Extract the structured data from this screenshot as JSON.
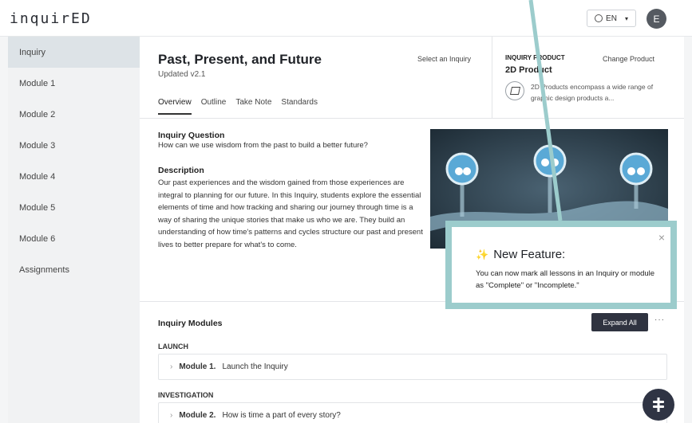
{
  "app": {
    "logo": "inquirED",
    "language": "EN",
    "avatar_initial": "E"
  },
  "sidebar": {
    "items": [
      {
        "label": "Inquiry",
        "active": true
      },
      {
        "label": "Module 1"
      },
      {
        "label": "Module 2"
      },
      {
        "label": "Module 3"
      },
      {
        "label": "Module 4"
      },
      {
        "label": "Module 5"
      },
      {
        "label": "Module 6"
      },
      {
        "label": "Assignments"
      }
    ]
  },
  "header": {
    "title": "Past, Present, and Future",
    "version": "Updated v2.1",
    "select_inquiry": "Select an Inquiry",
    "tabs": [
      {
        "label": "Overview",
        "active": true
      },
      {
        "label": "Outline"
      },
      {
        "label": "Take Note"
      },
      {
        "label": "Standards"
      }
    ]
  },
  "product": {
    "kicker": "INQUIRY PRODUCT",
    "change": "Change Product",
    "name": "2D Product",
    "description": "2D Products encompass a wide range of graphic design products a..."
  },
  "inquiry": {
    "question_heading": "Inquiry Question",
    "question": "How can we use wisdom from the past to build a better future?",
    "description_heading": "Description",
    "description": "Our past experiences and the wisdom gained from those experiences are integral to planning for our future. In this Inquiry, students explore the essential elements of time and how tracking and sharing our journey through time is a way of sharing the unique stories that make us who we are. They build an understanding of how time's patterns and cycles structure our past and present lives to better prepare for what's to come."
  },
  "modules": {
    "heading": "Inquiry Modules",
    "expand_all": "Expand All",
    "more": "···",
    "phases": [
      {
        "label": "LAUNCH",
        "module_num": "Module 1.",
        "module_title": "Launch the Inquiry"
      },
      {
        "label": "INVESTIGATION",
        "module_num": "Module 2.",
        "module_title": "How is time a part of every story?"
      }
    ]
  },
  "callout": {
    "title": "New Feature:",
    "text": "You can now mark all lessons in an Inquiry or module as \"Complete\" or \"Incomplete.\"",
    "close": "×",
    "spark": "✨"
  },
  "colors": {
    "callout_border": "#9ccccc",
    "sidebar_active": "#dde3e7",
    "button_dark": "#2f3340"
  }
}
